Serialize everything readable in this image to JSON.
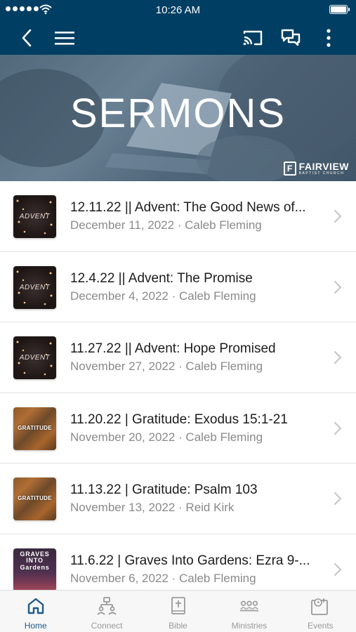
{
  "status_bar": {
    "time": "10:26 AM"
  },
  "nav": {
    "back_icon": "chevron-left-icon",
    "menu_icon": "hamburger-menu-icon",
    "cast_icon": "cast-icon",
    "chat_icon": "chat-bubbles-icon",
    "more_icon": "more-vertical-icon"
  },
  "banner": {
    "title": "SERMONS",
    "logo_name": "FAIRVIEW",
    "logo_sub": "BAPTIST CHURCH",
    "logo_mark": "F"
  },
  "sermons": [
    {
      "title": "12.11.22 || Advent: The Good News of...",
      "meta": "December 11, 2022 · Caleb Fleming",
      "thumb_text": "ADVENT",
      "thumb_style": "advent"
    },
    {
      "title": "12.4.22 || Advent: The Promise",
      "meta": "December 4, 2022 · Caleb Fleming",
      "thumb_text": "ADVENT",
      "thumb_style": "advent"
    },
    {
      "title": "11.27.22 || Advent: Hope Promised",
      "meta": "November 27, 2022 · Caleb Fleming",
      "thumb_text": "ADVENT",
      "thumb_style": "advent"
    },
    {
      "title": "11.20.22 | Gratitude: Exodus 15:1-21",
      "meta": "November 20, 2022 · Caleb Fleming",
      "thumb_text": "GRATITUDE",
      "thumb_style": "gratitude"
    },
    {
      "title": "11.13.22 | Gratitude: Psalm 103",
      "meta": "November 13, 2022 · Reid Kirk",
      "thumb_text": "GRATITUDE",
      "thumb_style": "gratitude"
    },
    {
      "title": "11.6.22 | Graves Into Gardens: Ezra 9-...",
      "meta": "November 6, 2022 · Caleb Fleming",
      "thumb_text": "GRAVES INTO Gardens",
      "thumb_style": "graves"
    }
  ],
  "tabs": [
    {
      "label": "Home",
      "icon": "home-icon",
      "active": true
    },
    {
      "label": "Connect",
      "icon": "connect-people-icon",
      "active": false
    },
    {
      "label": "Bible",
      "icon": "bible-icon",
      "active": false
    },
    {
      "label": "Ministries",
      "icon": "group-people-icon",
      "active": false
    },
    {
      "label": "Events",
      "icon": "calendar-clock-icon",
      "active": false
    }
  ],
  "colors": {
    "nav_background": "#003e63",
    "active_tab": "#1d5a8a",
    "inactive_tab": "#9a9a9a",
    "meta_text": "#8a8a8a"
  }
}
